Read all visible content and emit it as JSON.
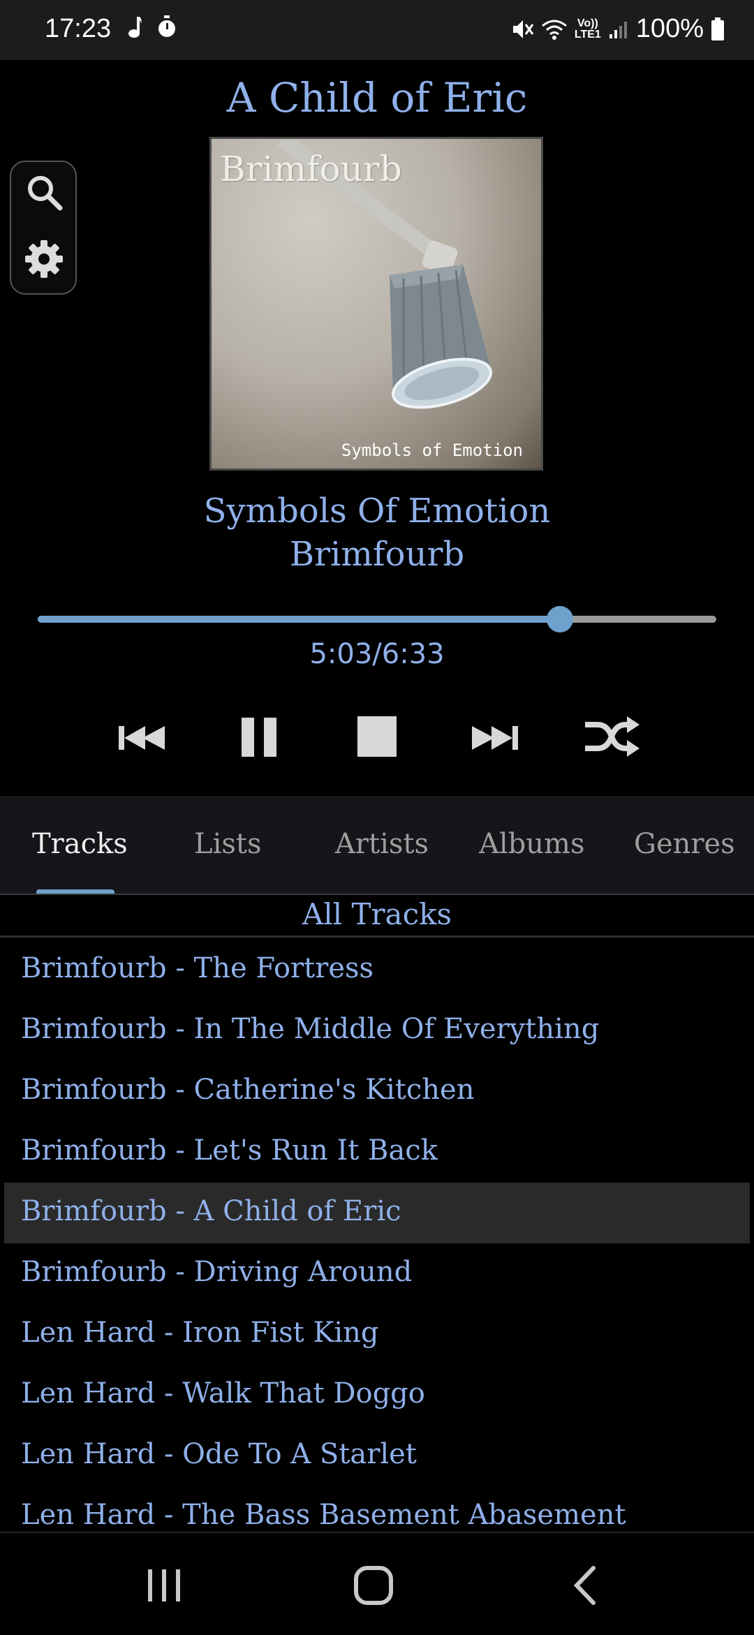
{
  "status_bar": {
    "time": "17:23",
    "battery": "100%",
    "left_icons": [
      "music-note-icon",
      "timer-icon"
    ],
    "right_icons": [
      "mute-icon",
      "wifi-icon",
      "volte-icon",
      "signal-icon",
      "battery-icon"
    ],
    "volte_label": "Vo)) LTE1"
  },
  "now_playing": {
    "title": "A Child of Eric",
    "album": "Symbols Of Emotion",
    "artist": "Brimfourb",
    "cover": {
      "brand_text": "Brimfourb",
      "subtitle_text": "Symbols of Emotion"
    },
    "elapsed": "5:03",
    "duration": "6:33",
    "time_display": "5:03/6:33",
    "progress_fraction": 0.77
  },
  "side_buttons": [
    "search-icon",
    "gear-icon"
  ],
  "controls": [
    "previous-icon",
    "pause-icon",
    "stop-icon",
    "next-icon",
    "shuffle-icon"
  ],
  "tabs": [
    {
      "label": "Tracks",
      "active": true
    },
    {
      "label": "Lists",
      "active": false
    },
    {
      "label": "Artists",
      "active": false
    },
    {
      "label": "Albums",
      "active": false
    },
    {
      "label": "Genres",
      "active": false
    }
  ],
  "list_heading": "All Tracks",
  "tracks": [
    "Brimfourb - The Fortress",
    "Brimfourb - In The Middle Of Everything",
    "Brimfourb - Catherine's Kitchen",
    "Brimfourb - Let's Run It Back",
    "Brimfourb - A Child of Eric",
    "Brimfourb - Driving Around",
    "Len Hard - Iron Fist King",
    "Len Hard - Walk That Doggo",
    "Len Hard - Ode To A Starlet",
    "Len Hard - The Bass Basement Abasement"
  ],
  "selected_track": "Brimfourb - A Child of Eric",
  "nav_bar": [
    "recents-icon",
    "home-icon",
    "back-icon"
  ],
  "colors": {
    "accent": "#6ea2cc",
    "text": "#8fb0ea",
    "background": "#000000",
    "tab_bar": "#16151a",
    "selected_row": "#2a2a2a"
  }
}
